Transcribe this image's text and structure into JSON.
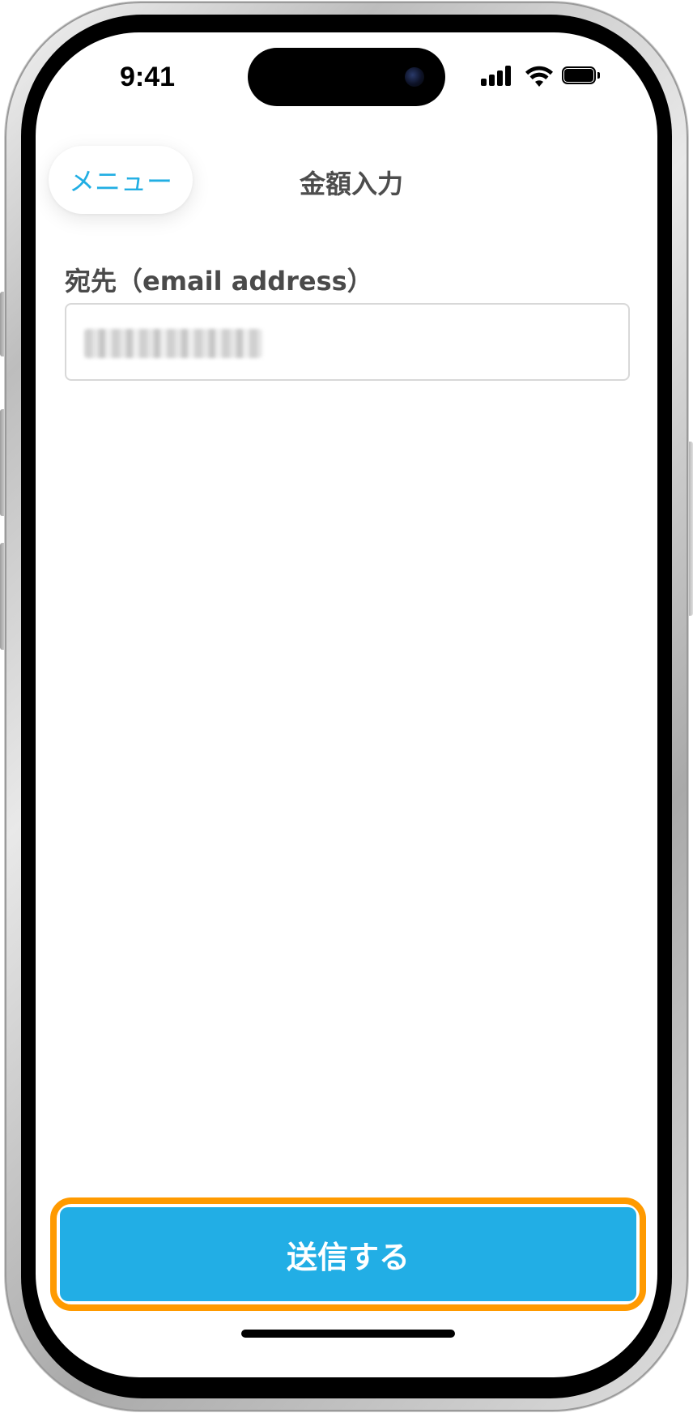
{
  "status_bar": {
    "time": "9:41",
    "icons": [
      "cellular-signal-icon",
      "wifi-icon",
      "battery-icon"
    ]
  },
  "nav": {
    "menu_label": "メニュー",
    "title": "金額入力"
  },
  "form": {
    "recipient_label": "宛先（email address）",
    "recipient_value": "",
    "recipient_value_obscured": true
  },
  "submit": {
    "label": "送信する",
    "highlighted": true
  },
  "colors": {
    "accent": "#22aee5",
    "menu_text": "#21aee3",
    "highlight": "#ff9a00",
    "label_text": "#4a4a4a"
  }
}
